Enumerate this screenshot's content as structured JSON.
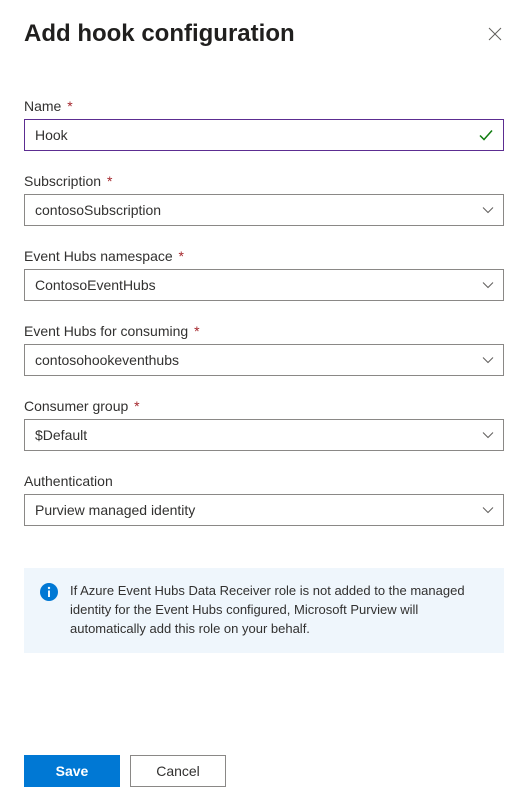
{
  "header": {
    "title": "Add hook configuration"
  },
  "fields": {
    "name": {
      "label": "Name",
      "value": "Hook"
    },
    "subscription": {
      "label": "Subscription",
      "value": "contosoSubscription"
    },
    "eventHubsNamespace": {
      "label": "Event Hubs namespace",
      "value": "ContosoEventHubs"
    },
    "eventHubsConsuming": {
      "label": "Event Hubs for consuming",
      "value": "contosohookeventhubs"
    },
    "consumerGroup": {
      "label": "Consumer group",
      "value": "$Default"
    },
    "authentication": {
      "label": "Authentication",
      "value": "Purview managed identity"
    }
  },
  "info": {
    "text": "If Azure Event Hubs Data Receiver role is not added to the managed identity for the Event Hubs configured, Microsoft Purview will automatically add this role on your behalf."
  },
  "footer": {
    "save": "Save",
    "cancel": "Cancel"
  },
  "required_marker": "*"
}
